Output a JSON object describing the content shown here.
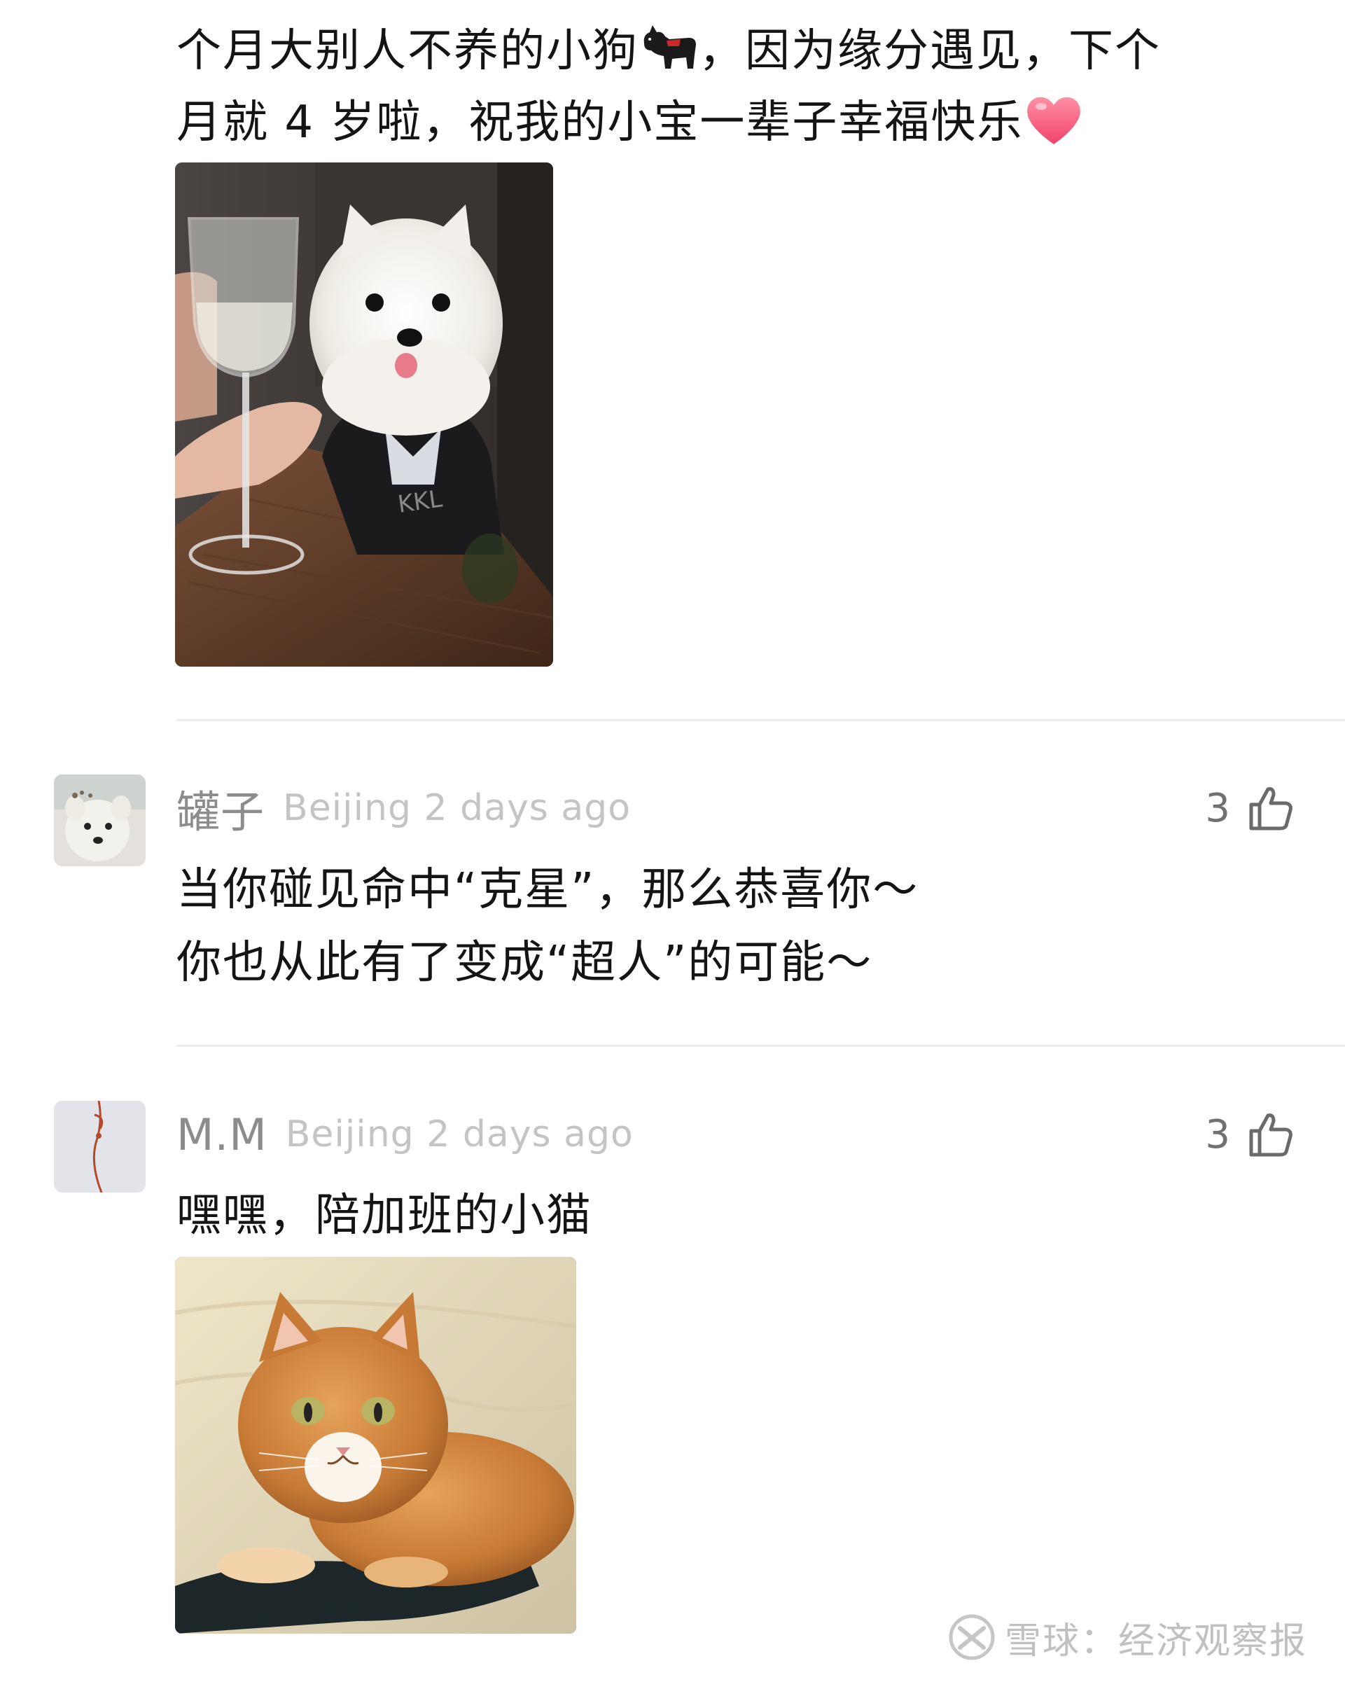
{
  "post": {
    "text_line1_a": "个月大别人不养的小狗",
    "text_line1_b": "，因为缘分遇见，下个",
    "text_line2": "月就 4 岁啦，祝我的小宝一辈子幸福快乐",
    "dog_emoji": "dog-emoji",
    "heart_emoji": "heart-emoji"
  },
  "comments": [
    {
      "name": "罐子",
      "meta": "Beijing 2 days ago",
      "likes": "3",
      "lines": [
        "当你碰见命中“克星”，那么恭喜你～",
        "你也从此有了变成“超人”的可能～"
      ],
      "avatar": "dog-avatar"
    },
    {
      "name": "M.M",
      "meta": "Beijing 2 days ago",
      "likes": "3",
      "lines": [
        "嘿嘿，陪加班的小猫"
      ],
      "avatar": "thread-avatar"
    }
  ],
  "icons": {
    "like": "thumbs-up-icon",
    "logo": "snowball-logo-icon"
  },
  "watermark": {
    "text": "雪球：经济观察报"
  },
  "colors": {
    "text": "#141414",
    "name": "#8c8c8c",
    "meta": "#c4c4c4",
    "divider": "#ececec",
    "heart": "#ff5a7a",
    "watermark": "#c0c0c0"
  }
}
